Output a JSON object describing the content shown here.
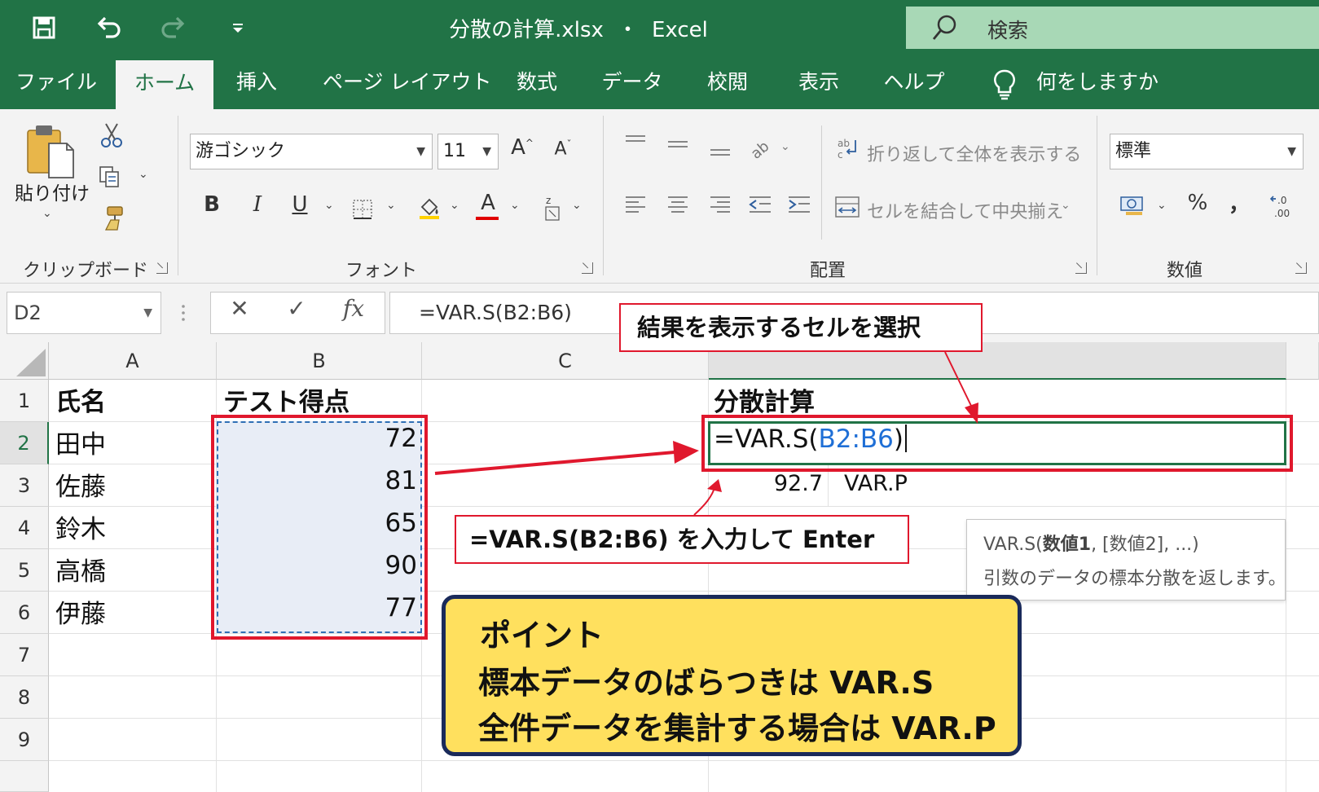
{
  "titlebar": {
    "title": "分散の計算.xlsx  ・  Excel",
    "search_label": "検索"
  },
  "tabs": [
    "ファイル",
    "ホーム",
    "挿入",
    "ページ レイアウト",
    "数式",
    "データ",
    "校閲",
    "表示",
    "ヘルプ"
  ],
  "tell_me": "何をしますか",
  "ribbon": {
    "clipboard": {
      "paste_label": "貼り付け",
      "group_label": "クリップボード"
    },
    "font": {
      "font_name": "游ゴシック",
      "font_size": "11",
      "group_label": "フォント",
      "bold": "B",
      "italic": "I",
      "underline": "U"
    },
    "alignment": {
      "wrap_text": "折り返して全体を表示する",
      "merge_center": "セルを結合して中央揃え",
      "group_label": "配置"
    },
    "number": {
      "format": "標準",
      "percent": "%",
      "comma": "，",
      "group_label": "数値"
    }
  },
  "formula_bar": {
    "name_box": "D2",
    "formula": "=VAR.S(B2:B6)"
  },
  "grid": {
    "columns": [
      "A",
      "B",
      "C"
    ],
    "rows": [
      "1",
      "2",
      "3",
      "4",
      "5",
      "6",
      "7",
      "8",
      "9"
    ],
    "header_name": "氏名",
    "header_score": "テスト得点",
    "names": [
      "田中",
      "佐藤",
      "鈴木",
      "高橋",
      "伊藤"
    ],
    "scores": [
      "72",
      "81",
      "65",
      "90",
      "77"
    ],
    "d1": "分散計算",
    "d2_prefix": "=VAR.S(",
    "d2_ref": "B2:B6",
    "d2_suffix": ")",
    "d3_value": "92.7",
    "e3_text": "VAR.P"
  },
  "callouts": {
    "select_cell": "結果を表示するセルを選択",
    "input_formula": "=VAR.S(B2:B6) を入力して Enter"
  },
  "tooltip": {
    "func": "VAR.S(",
    "arg1": "数値1",
    "rest": ", [数値2], ...)",
    "description": "引数のデータの標本分散を返します。"
  },
  "point": {
    "title": "ポイント",
    "line1": "標本データのばらつきは VAR.S",
    "line2": "全件データを集計する場合は VAR.P"
  },
  "colors": {
    "excel_green": "#217346",
    "callout_red": "#e0182d",
    "ref_blue": "#1f6fd6",
    "point_yellow": "#ffe05e",
    "point_border": "#1a2a5a"
  }
}
